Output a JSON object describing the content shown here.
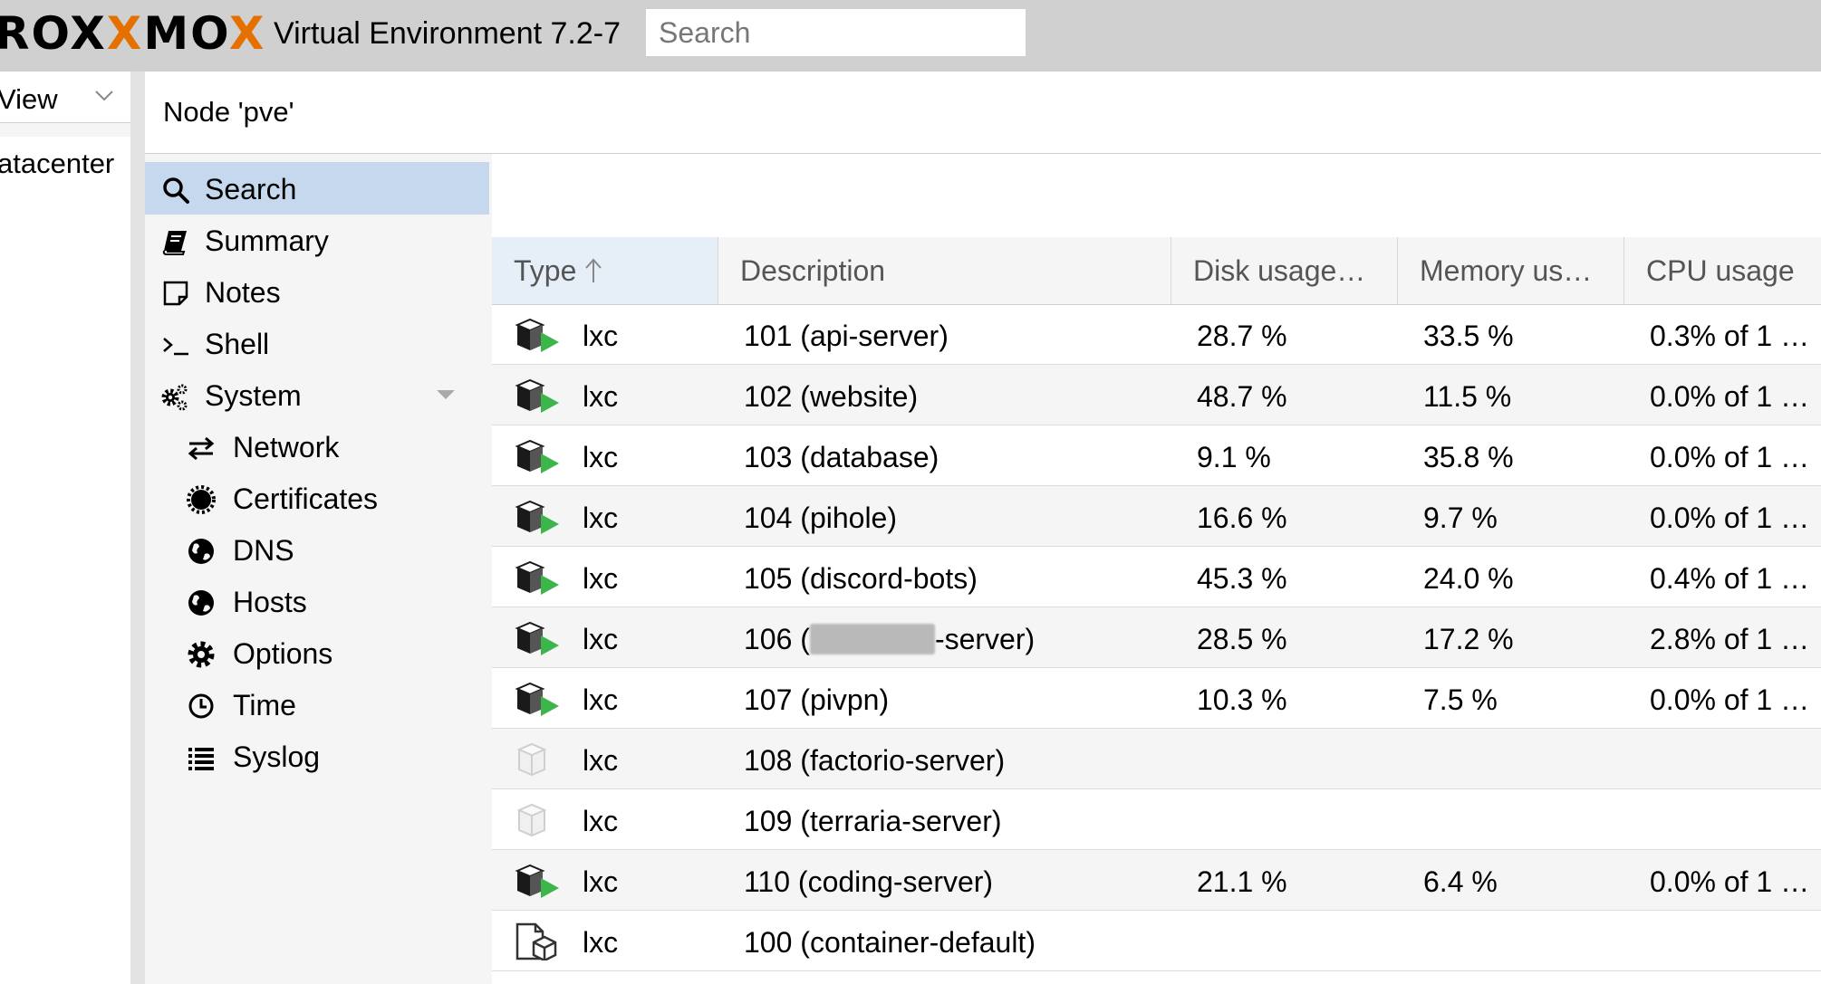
{
  "topbar": {
    "logo_left": "ROX",
    "logo_mid": "MO",
    "logo_x1": "X",
    "logo_x2": "X",
    "app_title": "Virtual Environment 7.2-7",
    "search_placeholder": "Search"
  },
  "left_panel": {
    "view_label": "View",
    "datacenter_label": "atacenter"
  },
  "node_header": {
    "title": "Node 'pve'"
  },
  "menu": {
    "items": [
      {
        "label": "Search",
        "icon": "search-icon",
        "selected": true
      },
      {
        "label": "Summary",
        "icon": "book-icon"
      },
      {
        "label": "Notes",
        "icon": "note-icon"
      },
      {
        "label": "Shell",
        "icon": "terminal-icon"
      },
      {
        "label": "System",
        "icon": "gears-icon",
        "expandable": true
      },
      {
        "label": "Network",
        "icon": "exchange-icon",
        "indent": true
      },
      {
        "label": "Certificates",
        "icon": "certificate-icon",
        "indent": true
      },
      {
        "label": "DNS",
        "icon": "globe-icon",
        "indent": true
      },
      {
        "label": "Hosts",
        "icon": "globe-icon",
        "indent": true
      },
      {
        "label": "Options",
        "icon": "gear-icon",
        "indent": true
      },
      {
        "label": "Time",
        "icon": "clock-icon",
        "indent": true
      },
      {
        "label": "Syslog",
        "icon": "list-icon",
        "indent": true
      }
    ]
  },
  "grid": {
    "columns": [
      "Type",
      "Description",
      "Disk usage…",
      "Memory us…",
      "CPU usage"
    ],
    "rows": [
      {
        "type": "lxc",
        "status": "running",
        "description": "101 (api-server)",
        "disk": "28.7 %",
        "memory": "33.5 %",
        "cpu": "0.3% of 1 …"
      },
      {
        "type": "lxc",
        "status": "running",
        "description": "102 (website)",
        "disk": "48.7 %",
        "memory": "11.5 %",
        "cpu": "0.0% of 1 …"
      },
      {
        "type": "lxc",
        "status": "running",
        "description": "103 (database)",
        "disk": "9.1 %",
        "memory": "35.8 %",
        "cpu": "0.0% of 1 …"
      },
      {
        "type": "lxc",
        "status": "running",
        "description": "104 (pihole)",
        "disk": "16.6 %",
        "memory": "9.7 %",
        "cpu": "0.0% of 1 …"
      },
      {
        "type": "lxc",
        "status": "running",
        "description": "105 (discord-bots)",
        "disk": "45.3 %",
        "memory": "24.0 %",
        "cpu": "0.4% of 1 …"
      },
      {
        "type": "lxc",
        "status": "running",
        "description_prefix": "106 (",
        "description_suffix": "-server)",
        "disk": "28.5 %",
        "memory": "17.2 %",
        "cpu": "2.8% of 1 …"
      },
      {
        "type": "lxc",
        "status": "running",
        "description": "107 (pivpn)",
        "disk": "10.3 %",
        "memory": "7.5 %",
        "cpu": "0.0% of 1 …"
      },
      {
        "type": "lxc",
        "status": "stopped",
        "description": "108 (factorio-server)",
        "disk": "",
        "memory": "",
        "cpu": ""
      },
      {
        "type": "lxc",
        "status": "stopped",
        "description": "109 (terraria-server)",
        "disk": "",
        "memory": "",
        "cpu": ""
      },
      {
        "type": "lxc",
        "status": "running",
        "description": "110 (coding-server)",
        "disk": "21.1 %",
        "memory": "6.4 %",
        "cpu": "0.0% of 1 …"
      },
      {
        "type": "lxc",
        "status": "template",
        "description": "100 (container-default)",
        "disk": "",
        "memory": "",
        "cpu": ""
      }
    ]
  },
  "colors": {
    "accent_orange": "#e57000",
    "selected_bg": "#c6d8ee",
    "running_green": "#3cb54a"
  }
}
